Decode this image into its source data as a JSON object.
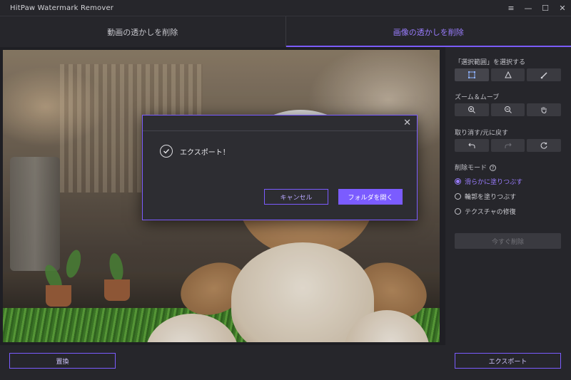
{
  "window": {
    "title": "HitPaw Watermark Remover",
    "controls": [
      "≡",
      "—",
      "☐",
      "✕"
    ]
  },
  "tabs": [
    {
      "label": "動画の透かしを削除",
      "active": false
    },
    {
      "label": "画像の透かしを削除",
      "active": true
    }
  ],
  "panel": {
    "select_area_label": "「選択範囲」を選択する",
    "select_tools": [
      "rectangle-select-icon",
      "polygon-select-icon",
      "brush-icon"
    ],
    "zoom_label": "ズーム＆ムーブ",
    "zoom_tools": [
      "zoom-in-icon",
      "zoom-out-icon",
      "hand-icon"
    ],
    "undo_label": "取り消す/元に戻す",
    "undo_tools": [
      "undo-icon",
      "redo-icon",
      "reset-icon"
    ],
    "mode_label": "削除モード",
    "modes": [
      {
        "label": "滑らかに塗りつぶす",
        "selected": true
      },
      {
        "label": "輪郭を塗りつぶす",
        "selected": false
      },
      {
        "label": "テクスチャの修復",
        "selected": false
      }
    ],
    "remove_now": "今すぐ削除"
  },
  "bottom": {
    "replace": "置換",
    "export": "エクスポート"
  },
  "dialog": {
    "message": "エクスポート！",
    "cancel": "キャンセル",
    "open_folder": "フォルダを開く"
  },
  "colors": {
    "accent": "#7b5cff",
    "background": "#1f1f24",
    "panel": "#26262b"
  }
}
